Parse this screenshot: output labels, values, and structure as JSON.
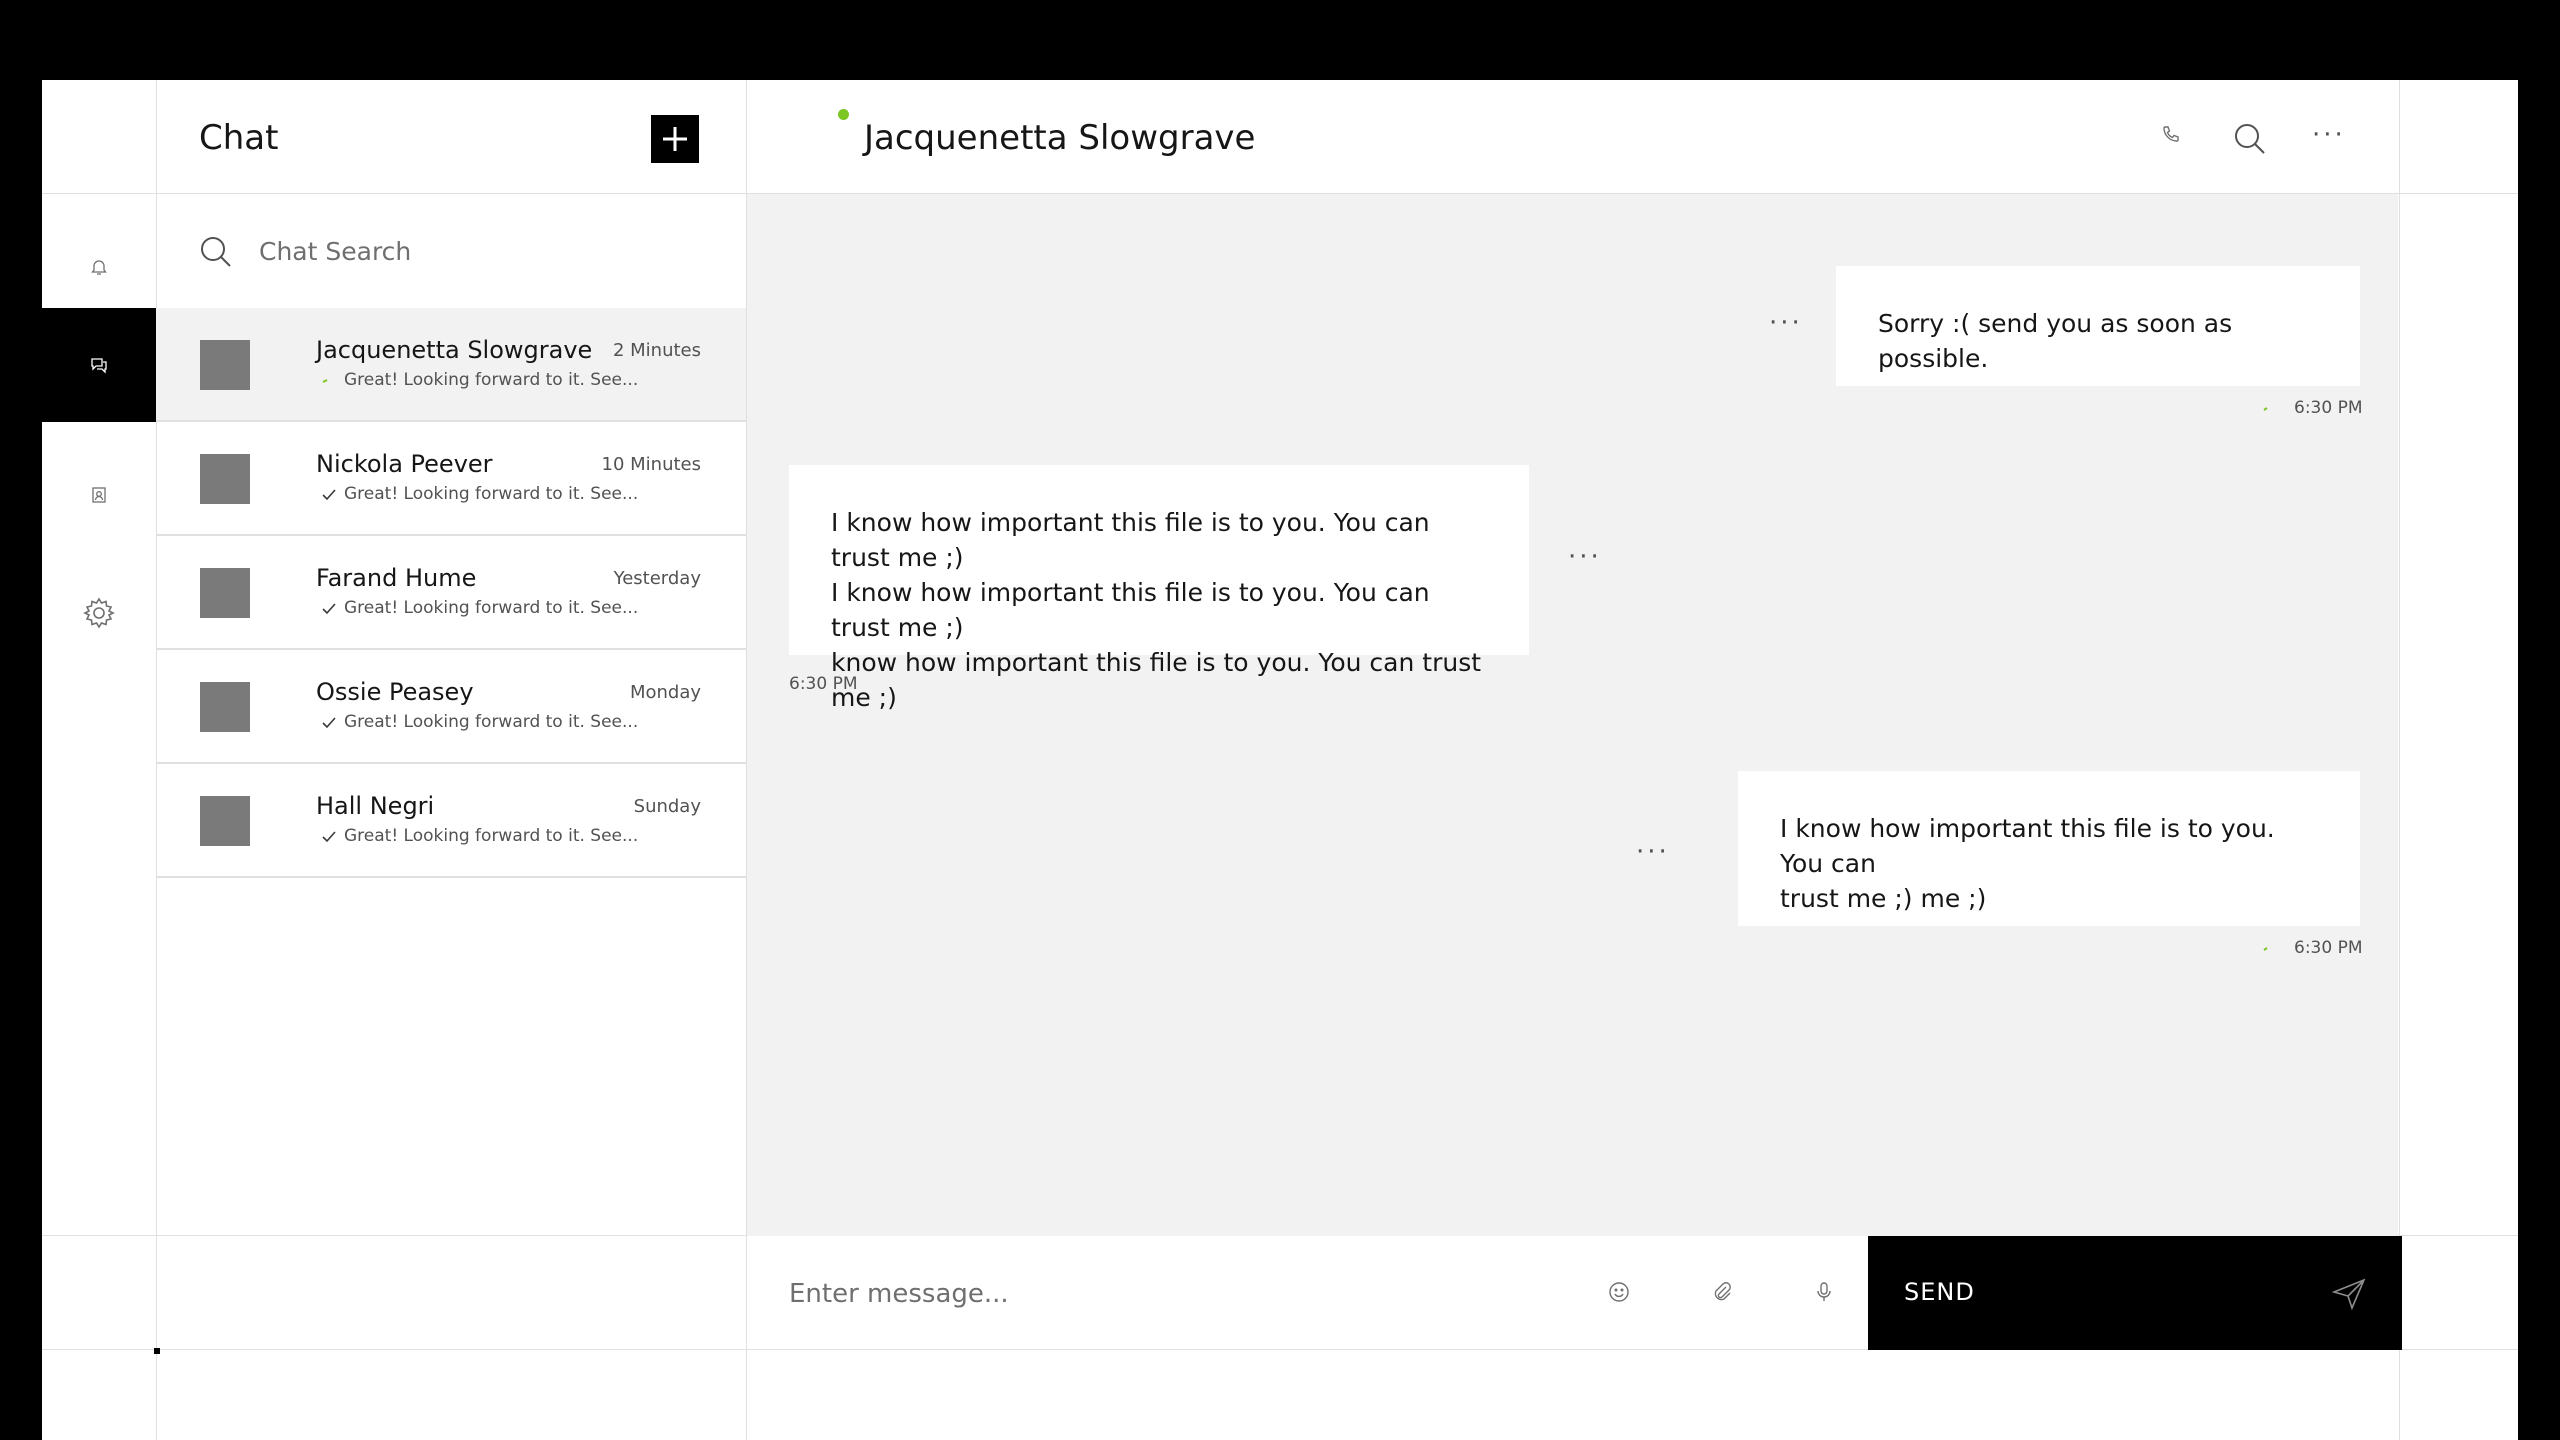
{
  "sidebar": {
    "items": [
      {
        "name": "notifications",
        "icon": "bell-icon",
        "active": false
      },
      {
        "name": "chat",
        "icon": "chat-icon",
        "active": true
      },
      {
        "name": "contacts",
        "icon": "contact-icon",
        "active": false
      },
      {
        "name": "settings",
        "icon": "gear-icon",
        "active": false
      }
    ]
  },
  "chat_list": {
    "title": "Chat",
    "new_chat_icon": "plus-icon",
    "search_placeholder": "Chat Search",
    "conversations": [
      {
        "name": "Jacquenetta Slowgrave",
        "time": "2 Minutes",
        "preview": "Great! Looking forward to it. See...",
        "status": "delivered-green"
      },
      {
        "name": "Nickola Peever",
        "time": "10 Minutes",
        "preview": "Great! Looking forward to it. See...",
        "status": "check"
      },
      {
        "name": "Farand Hume",
        "time": "Yesterday",
        "preview": "Great! Looking forward to it. See...",
        "status": "check"
      },
      {
        "name": "Ossie Peasey",
        "time": "Monday",
        "preview": "Great! Looking forward to it. See...",
        "status": "check"
      },
      {
        "name": "Hall Negri",
        "time": "Sunday",
        "preview": "Great! Looking forward to it. See...",
        "status": "check"
      }
    ]
  },
  "conversation": {
    "contact_name": "Jacquenetta Slowgrave",
    "online": true,
    "header_icons": [
      "phone-icon",
      "search-icon",
      "more-icon"
    ],
    "more_dots": "···",
    "messages": [
      {
        "side": "right",
        "lines": [
          "Sorry :( send you as soon as possible."
        ],
        "time": "6:30 PM"
      },
      {
        "side": "left",
        "lines": [
          "I know how important this file is to you. You can trust me ;)",
          "I know how important this file is to you. You can trust me ;)",
          "know how important this file is to you. You can trust me ;)"
        ],
        "time": "6:30 PM"
      },
      {
        "side": "right",
        "lines": [
          "I know how important this file is to you. You can",
          "trust me ;) me ;)"
        ],
        "time": "6:30 PM"
      }
    ]
  },
  "composer": {
    "placeholder": "Enter message...",
    "icons": [
      "emoji-icon",
      "attachment-icon",
      "microphone-icon"
    ],
    "send_label": "SEND",
    "send_icon": "send-icon"
  },
  "colors": {
    "accent_green": "#7cc623",
    "panel_bg": "#f2f2f2",
    "divider": "#e0e0e0",
    "active_black": "#000000"
  }
}
